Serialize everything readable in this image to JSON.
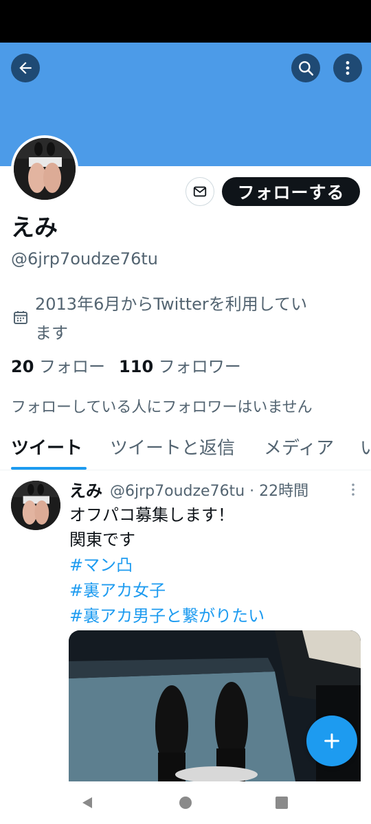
{
  "header": {
    "back_icon": "arrow-left-icon",
    "search_icon": "search-icon",
    "more_icon": "vertical-dots-icon",
    "banner_color": "#4c9be8"
  },
  "profile": {
    "name": "えみ",
    "handle": "@6jrp7oudze76tu",
    "joined_line1": "2013年6月からTwitterを利用してい",
    "joined_line2": "ます",
    "following_count": "20",
    "following_label": "フォロー",
    "followers_count": "110",
    "followers_label": "フォロワー",
    "common_followers_note": "フォローしている人にフォロワーはいません",
    "follow_button_label": "フォローする",
    "message_icon": "envelope-icon",
    "calendar_icon": "calendar-icon"
  },
  "tabs": [
    {
      "label": "ツイート",
      "active": true
    },
    {
      "label": "ツイートと返信",
      "active": false
    },
    {
      "label": "メディア",
      "active": false
    },
    {
      "label": "い",
      "active": false
    }
  ],
  "tweet": {
    "author_name": "えみ",
    "meta": "@6jrp7oudze76tu · 22時間",
    "lines": [
      "オフパコ募集します！",
      "関東です"
    ],
    "hashtags": [
      "#マン凸",
      "#裏アカ女子",
      "#裏アカ男子と繋がりたい"
    ]
  },
  "fab": {
    "icon": "plus-icon"
  },
  "system_nav": {
    "back_icon": "triangle-back-icon",
    "home_icon": "circle-home-icon",
    "recent_icon": "square-recents-icon"
  },
  "colors": {
    "accent": "#1d9bf0",
    "text_primary": "#0f1419",
    "text_secondary": "#536471"
  }
}
